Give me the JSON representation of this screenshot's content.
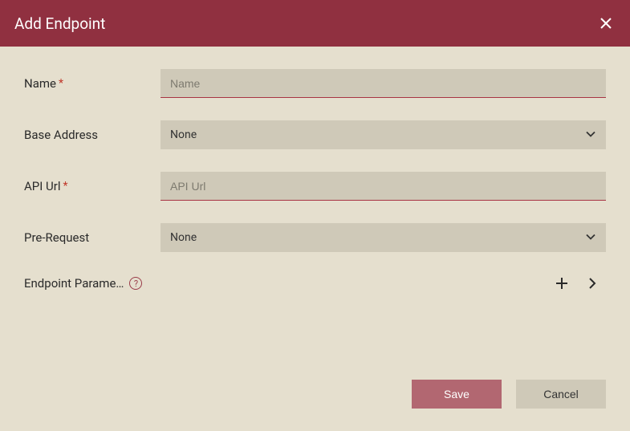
{
  "dialog": {
    "title": "Add Endpoint"
  },
  "form": {
    "name": {
      "label": "Name",
      "required": true,
      "placeholder": "Name",
      "value": ""
    },
    "baseAddress": {
      "label": "Base Address",
      "selected": "None"
    },
    "apiUrl": {
      "label": "API Url",
      "required": true,
      "placeholder": "API Url",
      "value": ""
    },
    "preRequest": {
      "label": "Pre-Request",
      "selected": "None"
    },
    "endpointParameters": {
      "label": "Endpoint Parame…"
    }
  },
  "buttons": {
    "save": "Save",
    "cancel": "Cancel"
  },
  "symbols": {
    "asterisk": "*",
    "question": "?"
  }
}
